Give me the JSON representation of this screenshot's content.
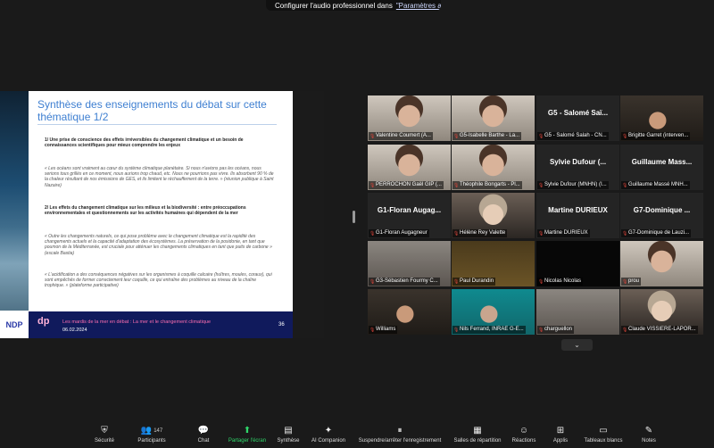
{
  "topbar": {
    "text": "Configurer l'audio professionnel dans",
    "link": "\"Paramètres audio\""
  },
  "slide": {
    "title": "Synthèse des enseignements du débat sur cette thématique 1/2",
    "p1": "1/ Une prise de conscience des effets irréversibles du changement climatique et un besoin de connaissances scientifiques pour mieux comprendre les enjeux",
    "q1": "« Les océans sont vraiment au cœur du système climatique planétaire. Si nous n'avions pas les océans, nous serions tous grillés en ce moment, nous aurions trop chaud, etc. Nous ne pourrions pas vivre. Ils absorbent 90 % de la chaleur résultant de nos émissions de GES, et ils limitent le réchauffement de la terre. » (réunion publique à Saint Nazaire)",
    "p2": "2/ Les effets du changement climatique sur les milieux et la biodiversité : entre préoccupations environnementales et questionnements sur les activités humaines qui dépendent de la mer",
    "q2": "« Outre les changements naturels, ce qui pose problème avec le changement climatique est la rapidité des changements actuels et la capacité d'adaptation des écosystèmes. La préservation de la posidonie, en tant que poumon de la Méditerranée, est cruciale pour atténuer les changements climatiques en tant que puits de carbone » (escale Bastia)",
    "q3": "« L'acidification a des conséquences négatives sur les organismes à coquille calcaire (huîtres, moules, coraux), qui sont empêchés de former correctement leur coquille, ce qui entraîne des problèmes au niveau de la chaîne trophique. » (plateforme participative)",
    "footer_logo": "dp",
    "footer_title": "Les mardis de la mer en débat : La mer et le changement climatique",
    "footer_date": "06.02.2024",
    "page_num": "36",
    "left_logo": "NDP"
  },
  "participants": [
    {
      "label": "Valentine Coumert (A...",
      "big": "",
      "photo": "person"
    },
    {
      "label": "G5-Isabelle Barthe - La...",
      "big": "",
      "photo": "person",
      "active": true
    },
    {
      "label": "G5 - Salomé Salah - CN...",
      "big": "G5 - Salomé Saï...",
      "photo": ""
    },
    {
      "label": "Brigitte Garret (interven...",
      "big": "",
      "photo": "room"
    },
    {
      "label": "PERROCHON Gaël GIP (...",
      "big": "",
      "photo": "person"
    },
    {
      "label": "Théophile Bongarts - Pl...",
      "big": "",
      "photo": "person"
    },
    {
      "label": "Sylvie Dufour (MNHN) (I...",
      "big": "Sylvie Dufour (...",
      "photo": ""
    },
    {
      "label": "Guillaume Massé MNH...",
      "big": "Guillaume Mass...",
      "photo": ""
    },
    {
      "label": "G1-Floran Augagneur",
      "big": "G1-Floran Augag...",
      "photo": ""
    },
    {
      "label": "Hélène Rey Valette",
      "big": "",
      "photo": "person2"
    },
    {
      "label": "Martine DURIEUX",
      "big": "Martine DURIEUX",
      "photo": ""
    },
    {
      "label": "G7-Dominique de Lauzi...",
      "big": "G7-Dominique ...",
      "photo": ""
    },
    {
      "label": "G3-Sébastien Fourmy C...",
      "big": "",
      "photo": "room2"
    },
    {
      "label": "Paul Durandin",
      "big": "",
      "photo": "warm"
    },
    {
      "label": "Nicolas Nicolas",
      "big": "",
      "photo": "black"
    },
    {
      "label": "prou",
      "big": "",
      "photo": "person"
    },
    {
      "label": "Williams",
      "big": "",
      "photo": "room"
    },
    {
      "label": "Nils Ferrand, INRAE G-E...",
      "big": "",
      "photo": "teal"
    },
    {
      "label": "charguellon",
      "big": "",
      "photo": "room2"
    },
    {
      "label": "Claude VISSIERE-LAPOR...",
      "big": "",
      "photo": "person2"
    }
  ],
  "more_label": "⌄",
  "toolbar": [
    {
      "label": "Sécurité",
      "icon": "shield-icon",
      "glyph": "⛨"
    },
    {
      "label": "Participants",
      "icon": "participants-icon",
      "glyph": "👥",
      "count": "147"
    },
    {
      "label": "Chat",
      "icon": "chat-icon",
      "glyph": "💬"
    },
    {
      "label": "Partager l'écran",
      "icon": "share-screen-icon",
      "glyph": "⬆",
      "green": true
    },
    {
      "label": "Synthèse",
      "icon": "summary-icon",
      "glyph": "▤"
    },
    {
      "label": "AI Companion",
      "icon": "ai-companion-icon",
      "glyph": "✦"
    },
    {
      "label": "Suspendre/arrêter l'enregistrement",
      "icon": "record-icon",
      "glyph": "⏸"
    },
    {
      "label": "Salles de répartition",
      "icon": "breakout-icon",
      "glyph": "▦"
    },
    {
      "label": "Réactions",
      "icon": "reactions-icon",
      "glyph": "☺"
    },
    {
      "label": "Applis",
      "icon": "apps-icon",
      "glyph": "⊞"
    },
    {
      "label": "Tableaux blancs",
      "icon": "whiteboard-icon",
      "glyph": "▭"
    },
    {
      "label": "Notes",
      "icon": "notes-icon",
      "glyph": "✎"
    }
  ]
}
